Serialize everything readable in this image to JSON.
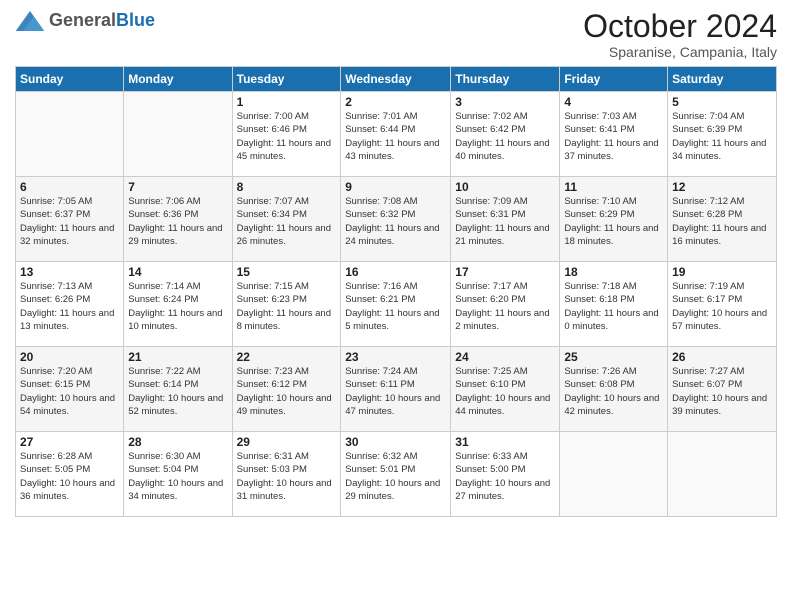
{
  "header": {
    "logo_general": "General",
    "logo_blue": "Blue",
    "month_title": "October 2024",
    "location": "Sparanise, Campania, Italy"
  },
  "weekdays": [
    "Sunday",
    "Monday",
    "Tuesday",
    "Wednesday",
    "Thursday",
    "Friday",
    "Saturday"
  ],
  "weeks": [
    [
      {
        "num": "",
        "sunrise": "",
        "sunset": "",
        "daylight": ""
      },
      {
        "num": "",
        "sunrise": "",
        "sunset": "",
        "daylight": ""
      },
      {
        "num": "1",
        "sunrise": "Sunrise: 7:00 AM",
        "sunset": "Sunset: 6:46 PM",
        "daylight": "Daylight: 11 hours and 45 minutes."
      },
      {
        "num": "2",
        "sunrise": "Sunrise: 7:01 AM",
        "sunset": "Sunset: 6:44 PM",
        "daylight": "Daylight: 11 hours and 43 minutes."
      },
      {
        "num": "3",
        "sunrise": "Sunrise: 7:02 AM",
        "sunset": "Sunset: 6:42 PM",
        "daylight": "Daylight: 11 hours and 40 minutes."
      },
      {
        "num": "4",
        "sunrise": "Sunrise: 7:03 AM",
        "sunset": "Sunset: 6:41 PM",
        "daylight": "Daylight: 11 hours and 37 minutes."
      },
      {
        "num": "5",
        "sunrise": "Sunrise: 7:04 AM",
        "sunset": "Sunset: 6:39 PM",
        "daylight": "Daylight: 11 hours and 34 minutes."
      }
    ],
    [
      {
        "num": "6",
        "sunrise": "Sunrise: 7:05 AM",
        "sunset": "Sunset: 6:37 PM",
        "daylight": "Daylight: 11 hours and 32 minutes."
      },
      {
        "num": "7",
        "sunrise": "Sunrise: 7:06 AM",
        "sunset": "Sunset: 6:36 PM",
        "daylight": "Daylight: 11 hours and 29 minutes."
      },
      {
        "num": "8",
        "sunrise": "Sunrise: 7:07 AM",
        "sunset": "Sunset: 6:34 PM",
        "daylight": "Daylight: 11 hours and 26 minutes."
      },
      {
        "num": "9",
        "sunrise": "Sunrise: 7:08 AM",
        "sunset": "Sunset: 6:32 PM",
        "daylight": "Daylight: 11 hours and 24 minutes."
      },
      {
        "num": "10",
        "sunrise": "Sunrise: 7:09 AM",
        "sunset": "Sunset: 6:31 PM",
        "daylight": "Daylight: 11 hours and 21 minutes."
      },
      {
        "num": "11",
        "sunrise": "Sunrise: 7:10 AM",
        "sunset": "Sunset: 6:29 PM",
        "daylight": "Daylight: 11 hours and 18 minutes."
      },
      {
        "num": "12",
        "sunrise": "Sunrise: 7:12 AM",
        "sunset": "Sunset: 6:28 PM",
        "daylight": "Daylight: 11 hours and 16 minutes."
      }
    ],
    [
      {
        "num": "13",
        "sunrise": "Sunrise: 7:13 AM",
        "sunset": "Sunset: 6:26 PM",
        "daylight": "Daylight: 11 hours and 13 minutes."
      },
      {
        "num": "14",
        "sunrise": "Sunrise: 7:14 AM",
        "sunset": "Sunset: 6:24 PM",
        "daylight": "Daylight: 11 hours and 10 minutes."
      },
      {
        "num": "15",
        "sunrise": "Sunrise: 7:15 AM",
        "sunset": "Sunset: 6:23 PM",
        "daylight": "Daylight: 11 hours and 8 minutes."
      },
      {
        "num": "16",
        "sunrise": "Sunrise: 7:16 AM",
        "sunset": "Sunset: 6:21 PM",
        "daylight": "Daylight: 11 hours and 5 minutes."
      },
      {
        "num": "17",
        "sunrise": "Sunrise: 7:17 AM",
        "sunset": "Sunset: 6:20 PM",
        "daylight": "Daylight: 11 hours and 2 minutes."
      },
      {
        "num": "18",
        "sunrise": "Sunrise: 7:18 AM",
        "sunset": "Sunset: 6:18 PM",
        "daylight": "Daylight: 11 hours and 0 minutes."
      },
      {
        "num": "19",
        "sunrise": "Sunrise: 7:19 AM",
        "sunset": "Sunset: 6:17 PM",
        "daylight": "Daylight: 10 hours and 57 minutes."
      }
    ],
    [
      {
        "num": "20",
        "sunrise": "Sunrise: 7:20 AM",
        "sunset": "Sunset: 6:15 PM",
        "daylight": "Daylight: 10 hours and 54 minutes."
      },
      {
        "num": "21",
        "sunrise": "Sunrise: 7:22 AM",
        "sunset": "Sunset: 6:14 PM",
        "daylight": "Daylight: 10 hours and 52 minutes."
      },
      {
        "num": "22",
        "sunrise": "Sunrise: 7:23 AM",
        "sunset": "Sunset: 6:12 PM",
        "daylight": "Daylight: 10 hours and 49 minutes."
      },
      {
        "num": "23",
        "sunrise": "Sunrise: 7:24 AM",
        "sunset": "Sunset: 6:11 PM",
        "daylight": "Daylight: 10 hours and 47 minutes."
      },
      {
        "num": "24",
        "sunrise": "Sunrise: 7:25 AM",
        "sunset": "Sunset: 6:10 PM",
        "daylight": "Daylight: 10 hours and 44 minutes."
      },
      {
        "num": "25",
        "sunrise": "Sunrise: 7:26 AM",
        "sunset": "Sunset: 6:08 PM",
        "daylight": "Daylight: 10 hours and 42 minutes."
      },
      {
        "num": "26",
        "sunrise": "Sunrise: 7:27 AM",
        "sunset": "Sunset: 6:07 PM",
        "daylight": "Daylight: 10 hours and 39 minutes."
      }
    ],
    [
      {
        "num": "27",
        "sunrise": "Sunrise: 6:28 AM",
        "sunset": "Sunset: 5:05 PM",
        "daylight": "Daylight: 10 hours and 36 minutes."
      },
      {
        "num": "28",
        "sunrise": "Sunrise: 6:30 AM",
        "sunset": "Sunset: 5:04 PM",
        "daylight": "Daylight: 10 hours and 34 minutes."
      },
      {
        "num": "29",
        "sunrise": "Sunrise: 6:31 AM",
        "sunset": "Sunset: 5:03 PM",
        "daylight": "Daylight: 10 hours and 31 minutes."
      },
      {
        "num": "30",
        "sunrise": "Sunrise: 6:32 AM",
        "sunset": "Sunset: 5:01 PM",
        "daylight": "Daylight: 10 hours and 29 minutes."
      },
      {
        "num": "31",
        "sunrise": "Sunrise: 6:33 AM",
        "sunset": "Sunset: 5:00 PM",
        "daylight": "Daylight: 10 hours and 27 minutes."
      },
      {
        "num": "",
        "sunrise": "",
        "sunset": "",
        "daylight": ""
      },
      {
        "num": "",
        "sunrise": "",
        "sunset": "",
        "daylight": ""
      }
    ]
  ]
}
